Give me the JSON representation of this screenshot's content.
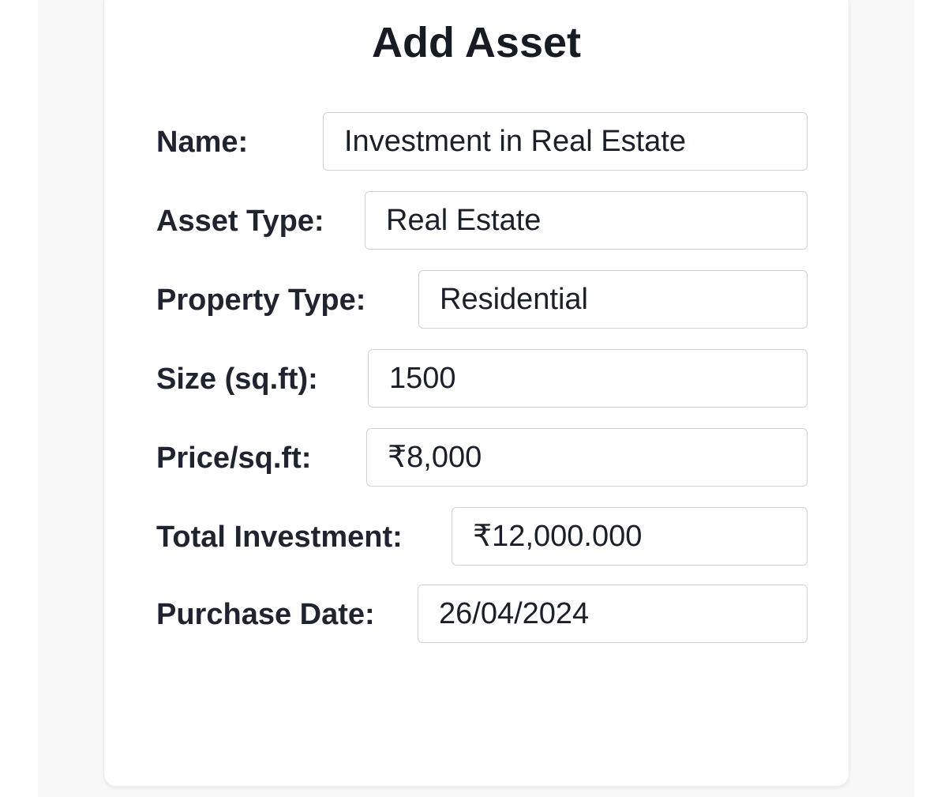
{
  "form": {
    "title": "Add Asset",
    "fields": [
      {
        "label": "Name:",
        "value": "Investment in Real Estate"
      },
      {
        "label": "Asset Type:",
        "value": "Real Estate"
      },
      {
        "label": "Property Type:",
        "value": "Residential"
      },
      {
        "label": "Size (sq.ft):",
        "value": "1500"
      },
      {
        "label": "Price/sq.ft:",
        "value": "₹8,000"
      },
      {
        "label": "Total Investment:",
        "value": "₹12,000.000"
      },
      {
        "label": "Purchase Date:",
        "value": "26/04/2024"
      }
    ]
  }
}
